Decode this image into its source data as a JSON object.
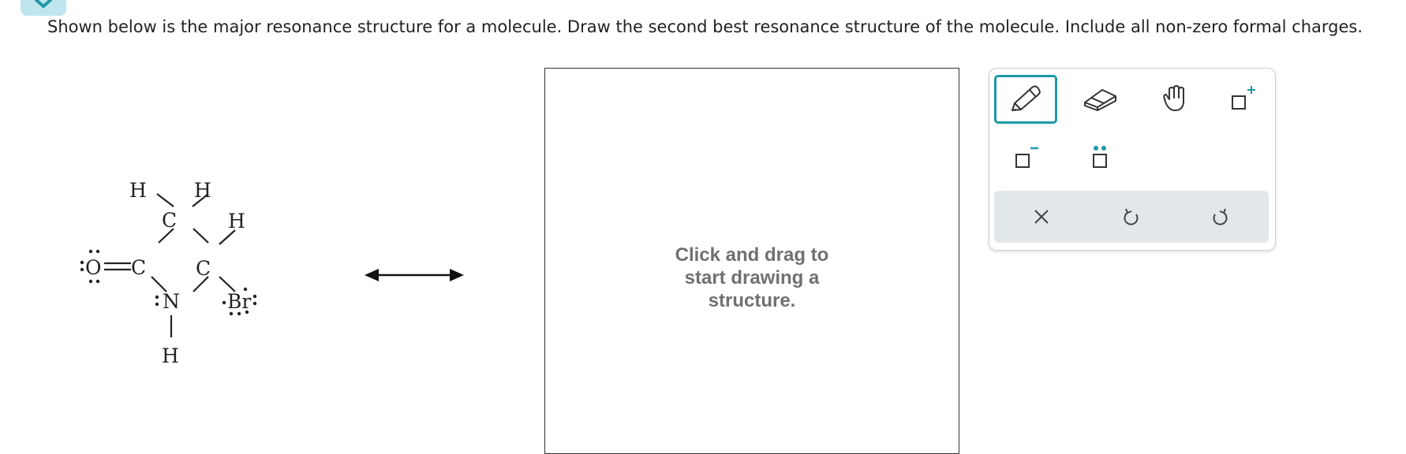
{
  "prompt": "Shown below is the major resonance structure for a molecule. Draw the second best resonance structure of the molecule. Include all non-zero formal charges.",
  "molecule": {
    "atoms": {
      "h_top_left": "H",
      "h_top_right": "H",
      "c_top": "C",
      "h_right": "H",
      "o": "O",
      "c_left": "C",
      "c_right": "C",
      "n": "N",
      "br": "Br",
      "h_bottom": "H"
    }
  },
  "canvas": {
    "hint": "Click and drag to start drawing a structure."
  },
  "toolbar": {
    "tools": [
      {
        "name": "pencil-tool",
        "icon": "pencil-icon",
        "active": true
      },
      {
        "name": "eraser-tool",
        "icon": "eraser-icon"
      },
      {
        "name": "pan-tool",
        "icon": "hand-icon"
      },
      {
        "name": "positive-charge-tool",
        "icon": "plus-charge-icon"
      },
      {
        "name": "negative-charge-tool",
        "icon": "minus-charge-icon"
      },
      {
        "name": "lone-pair-tool",
        "icon": "lone-pair-icon"
      }
    ],
    "actions": [
      {
        "name": "clear-button",
        "icon": "close-icon"
      },
      {
        "name": "undo-button",
        "icon": "undo-icon"
      },
      {
        "name": "redo-button",
        "icon": "redo-icon"
      }
    ],
    "accent_color": "#1f98a8",
    "charge_plus_color": "#1f98a8"
  }
}
